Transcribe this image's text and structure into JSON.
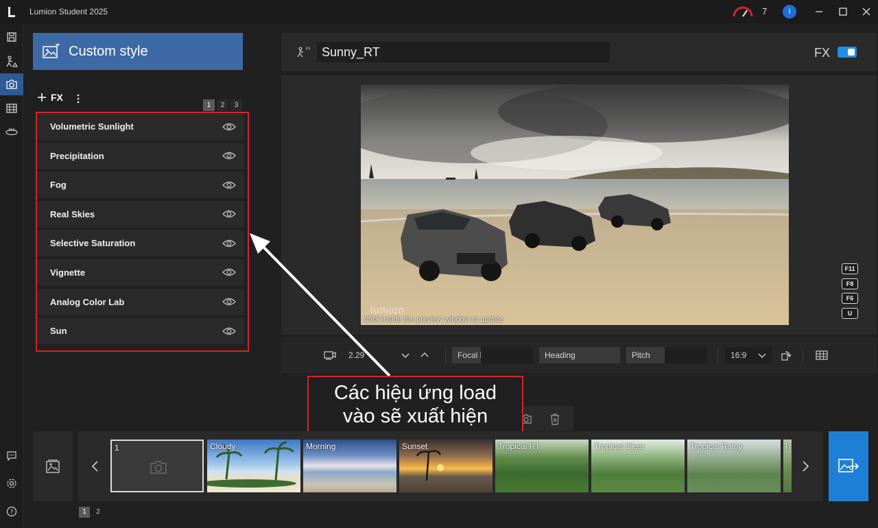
{
  "window": {
    "title": "Lumion Student 2025",
    "notification_count": "7",
    "avatar_initial": "I"
  },
  "left_panel": {
    "custom_style_label": "Custom style",
    "fx_add_label": "FX",
    "pages": [
      "1",
      "2",
      "3"
    ],
    "effects": [
      "Volumetric Sunlight",
      "Precipitation",
      "Fog",
      "Real Skies",
      "Selective Saturation",
      "Vignette",
      "Analog Color Lab",
      "Sun"
    ]
  },
  "preset": {
    "name": "Sunny_RT",
    "fx_label": "FX",
    "fx_enabled": true
  },
  "preview": {
    "watermark": "lumion",
    "hint": "Click inside the preview window to update",
    "shortcut_keys": [
      "F11",
      "F8",
      "F6",
      "U"
    ]
  },
  "camera": {
    "focal_value": "2.29",
    "focal_length_label": "Focal length",
    "heading_label": "Heading",
    "pitch_label": "Pitch",
    "aspect_ratio": "16:9"
  },
  "annotation": {
    "line1": "Các hiệu ứng load",
    "line2": "vào sẽ xuất hiện"
  },
  "thumbnails": [
    {
      "label": "1"
    },
    {
      "label": "Cloudy"
    },
    {
      "label": "Morning"
    },
    {
      "label": "Sunset"
    },
    {
      "label": "Tropical RT"
    },
    {
      "label": "Tropical Clear"
    },
    {
      "label": "Tropical Rainy"
    },
    {
      "label": "Tr"
    }
  ],
  "bottom_pages": [
    "1",
    "2"
  ],
  "colors": {
    "accent": "#3d6aa6",
    "render_blue": "#1e7fd6",
    "annotation_red": "#d8232a"
  }
}
